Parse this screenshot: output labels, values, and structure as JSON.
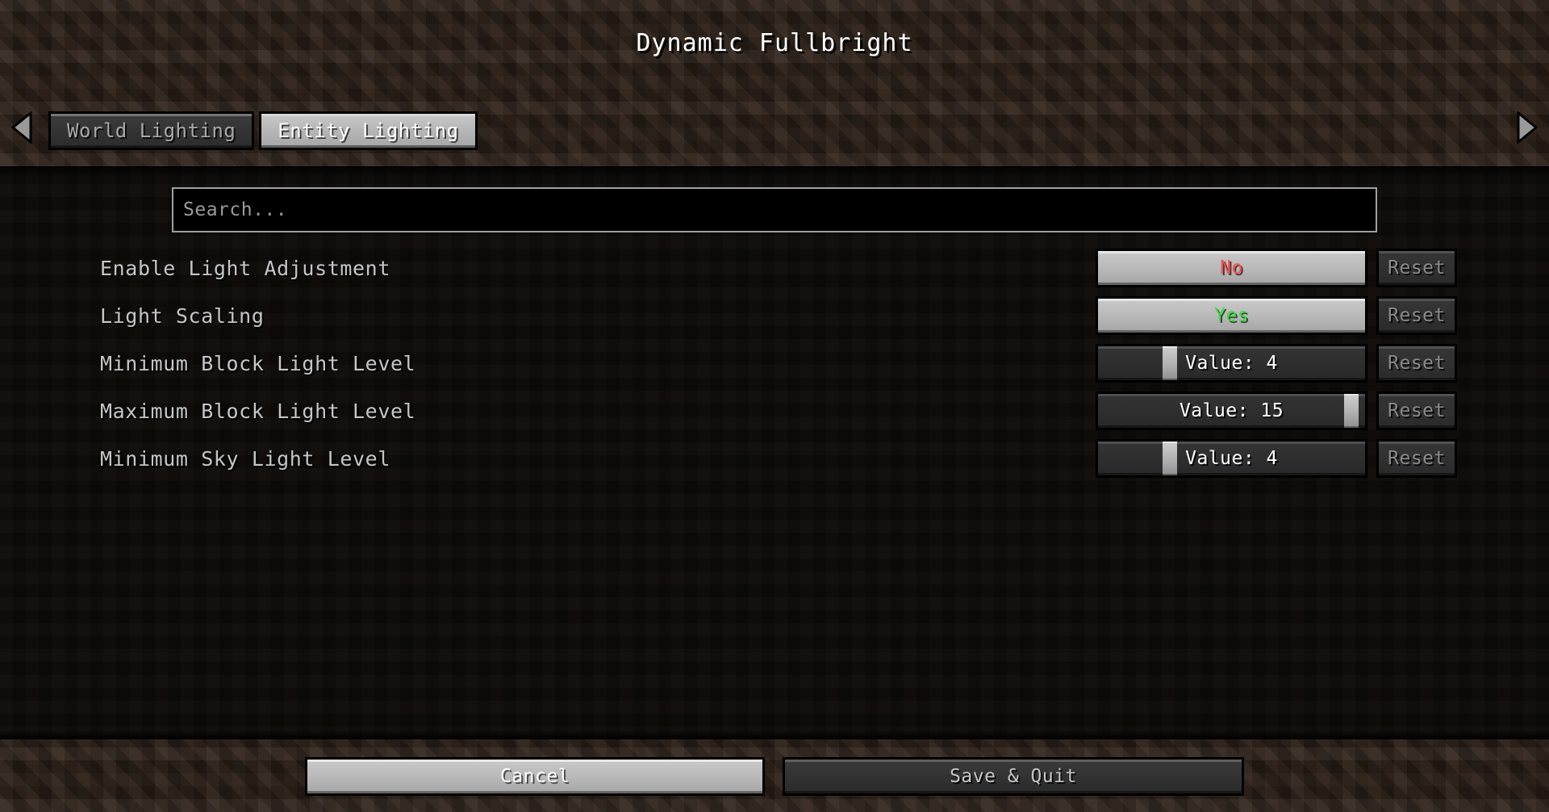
{
  "window": {
    "title": "Dynamic Fullbright"
  },
  "nav": {
    "prev_icon": "left-arrow-icon",
    "next_icon": "right-arrow-icon"
  },
  "tabs": [
    {
      "label": "World Lighting",
      "active": false
    },
    {
      "label": "Entity Lighting",
      "active": true
    }
  ],
  "search": {
    "value": "",
    "placeholder": "Search..."
  },
  "settings": [
    {
      "label": "Enable Light Adjustment",
      "control": {
        "type": "toggle",
        "value": "No",
        "state": "no"
      },
      "reset": {
        "label": "Reset",
        "enabled": false
      }
    },
    {
      "label": "Light Scaling",
      "control": {
        "type": "toggle",
        "value": "Yes",
        "state": "yes"
      },
      "reset": {
        "label": "Reset",
        "enabled": false
      }
    },
    {
      "label": "Minimum Block Light Level",
      "control": {
        "type": "slider",
        "value": "Value: 4",
        "number": 4,
        "min": 0,
        "max": 15,
        "percent": 27
      },
      "reset": {
        "label": "Reset",
        "enabled": false
      }
    },
    {
      "label": "Maximum Block Light Level",
      "control": {
        "type": "slider",
        "value": "Value: 15",
        "number": 15,
        "min": 0,
        "max": 15,
        "percent": 95
      },
      "reset": {
        "label": "Reset",
        "enabled": false
      }
    },
    {
      "label": "Minimum Sky Light Level",
      "control": {
        "type": "slider",
        "value": "Value: 4",
        "number": 4,
        "min": 0,
        "max": 15,
        "percent": 27
      },
      "reset": {
        "label": "Reset",
        "enabled": false
      }
    }
  ],
  "footer": {
    "cancel_label": "Cancel",
    "save_label": "Save & Quit"
  },
  "colors": {
    "dirt": "#2b2018",
    "content_bg": "#0d0a07",
    "button_normal": "#333333",
    "button_highlight": "#b6b6b6",
    "text_primary": "#c6c6c6",
    "text_white": "#ffffff",
    "text_disabled": "#8a8a8a",
    "value_yes": "#36e036",
    "value_no": "#ff4f4f"
  }
}
